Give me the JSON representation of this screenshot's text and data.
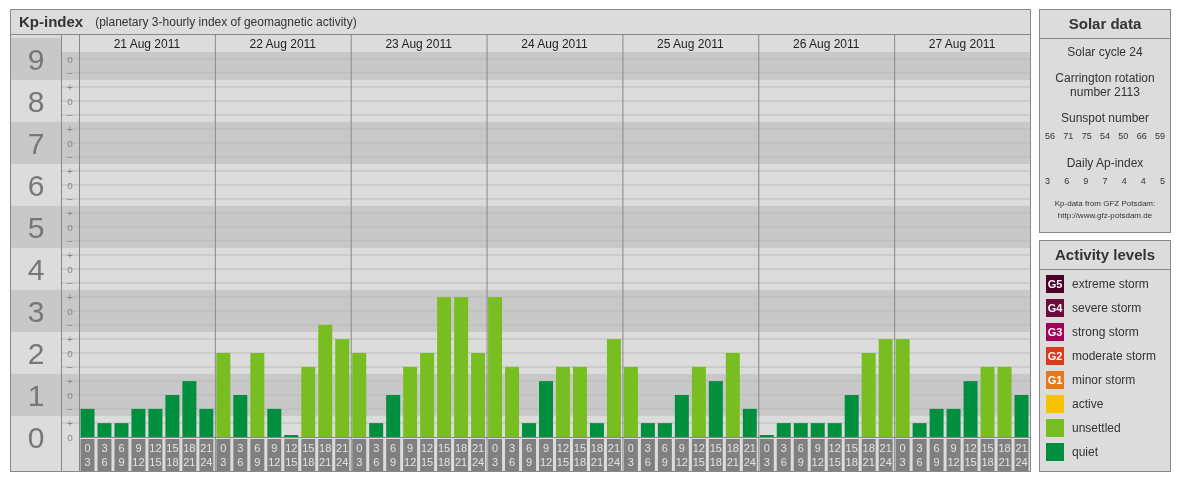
{
  "kp_panel": {
    "title": "Kp-index",
    "subtitle": "(planetary 3-hourly index of geomagnetic activity)",
    "days": [
      "21 Aug 2011",
      "22 Aug 2011",
      "23 Aug 2011",
      "24 Aug 2011",
      "25 Aug 2011",
      "26 Aug 2011",
      "27 Aug 2011"
    ],
    "scale_marks": [
      "o",
      "−",
      "+",
      "o",
      "−",
      "+",
      "o",
      "−",
      "+",
      "o",
      "−",
      "+",
      "o",
      "−",
      "+",
      "o",
      "−",
      "+",
      "o",
      "−",
      "+",
      "o",
      "−",
      "+",
      "o",
      "−",
      "+",
      "o"
    ],
    "chart_data": {
      "type": "bar",
      "stacked": true,
      "grid": true,
      "ylim": [
        0,
        9.57
      ],
      "yticks": [
        0,
        1,
        2,
        3,
        4,
        5,
        6,
        7,
        8,
        9
      ],
      "categories": [
        "0 3",
        "3 6",
        "6 9",
        "9 12",
        "12 15",
        "15 18",
        "18 21",
        "21 24",
        "0 3",
        "3 6",
        "6 9",
        "9 12",
        "12 15",
        "15 18",
        "18 21",
        "21 24",
        "0 3",
        "3 6",
        "6 9",
        "9 12",
        "12 15",
        "15 18",
        "18 21",
        "21 24",
        "0 3",
        "3 6",
        "6 9",
        "9 12",
        "12 15",
        "15 18",
        "18 21",
        "21 24",
        "0 3",
        "3 6",
        "6 9",
        "9 12",
        "12 15",
        "15 18",
        "18 21",
        "21 24",
        "0 3",
        "3 6",
        "6 9",
        "9 12",
        "12 15",
        "15 18",
        "18 21",
        "21 24",
        "0 3",
        "3 6",
        "6 9",
        "9 12",
        "12 15",
        "15 18",
        "18 21",
        "21 24"
      ],
      "series": [
        {
          "color": "#008f3e",
          "values": [
            0.67,
            0.33,
            0.33,
            0.67,
            0.67,
            1,
            1.33,
            0.67,
            null,
            1,
            null,
            0.67,
            0,
            null,
            null,
            null,
            null,
            0.33,
            1,
            null,
            null,
            null,
            null,
            null,
            null,
            null,
            0.33,
            1.33,
            null,
            null,
            0.33,
            null,
            null,
            0.33,
            0.33,
            1,
            null,
            1.33,
            null,
            0.67,
            0,
            0.33,
            0.33,
            0.33,
            0.33,
            1,
            null,
            null,
            null,
            0.33,
            0.67,
            0.67,
            1.33,
            null,
            null,
            1
          ]
        },
        {
          "color": "#78be20",
          "values": [
            null,
            null,
            null,
            null,
            null,
            null,
            null,
            null,
            2,
            null,
            2,
            null,
            null,
            1.67,
            2.67,
            2.33,
            2,
            null,
            null,
            1.67,
            2,
            3.33,
            3.33,
            2,
            3.33,
            1.67,
            null,
            null,
            1.67,
            1.67,
            null,
            2.33,
            1.67,
            null,
            null,
            null,
            1.67,
            null,
            2,
            null,
            null,
            null,
            null,
            null,
            null,
            null,
            2,
            2.33,
            2.33,
            null,
            null,
            null,
            null,
            1.67,
            1.67,
            null
          ]
        }
      ]
    }
  },
  "solar_data": {
    "title": "Solar data",
    "solar_cycle": "Solar cycle 24",
    "carrington": "Carrington rotation number 2113",
    "sunspot_heading": "Sunspot number",
    "sunspots": [
      "56",
      "71",
      "75",
      "54",
      "50",
      "66",
      "59"
    ],
    "ap_heading": "Daily Ap-index",
    "ap_values": [
      "3",
      "6",
      "9",
      "7",
      "4",
      "4",
      "5"
    ],
    "source": "Kp-data from GFZ Potsdam:",
    "source_url": "http://www.gfz-potsdam.de"
  },
  "activity_levels": {
    "title": "Activity levels",
    "items": [
      {
        "code": "G5",
        "label": "extreme storm",
        "color": "#4d0026"
      },
      {
        "code": "G4",
        "label": "severe storm",
        "color": "#6b0a3c"
      },
      {
        "code": "G3",
        "label": "strong storm",
        "color": "#a3005a"
      },
      {
        "code": "G2",
        "label": "moderate storm",
        "color": "#d83a1c"
      },
      {
        "code": "G1",
        "label": "minor storm",
        "color": "#e8781c"
      },
      {
        "label": "active",
        "color": "#f7c200"
      },
      {
        "label": "unsettled",
        "color": "#78be20"
      },
      {
        "label": "quiet",
        "color": "#008f3e"
      }
    ]
  }
}
